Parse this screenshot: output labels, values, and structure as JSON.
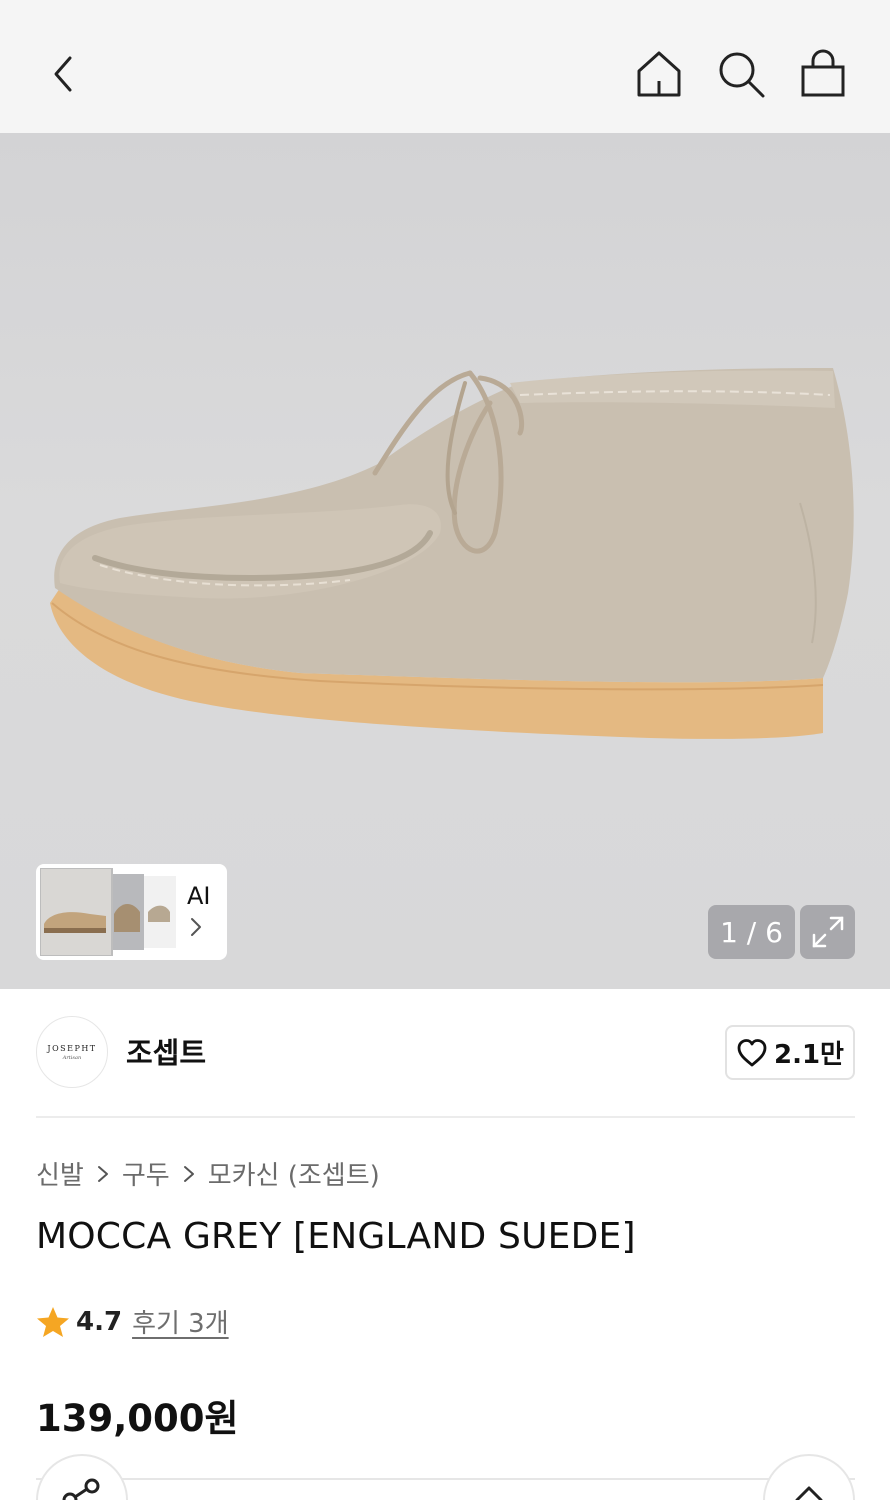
{
  "header": {
    "back_icon": "chevron-left-icon",
    "home_icon": "home-icon",
    "search_icon": "search-icon",
    "cart_icon": "shopping-bag-icon"
  },
  "gallery": {
    "counter": "1 / 6",
    "ai_label": "AI",
    "expand_icon": "expand-icon",
    "current_index": 1,
    "total": 6
  },
  "brand": {
    "name": "조셉트",
    "logo_text": "JOSEPHT",
    "logo_subtext": "Artisan",
    "like_count": "2.1만"
  },
  "breadcrumb": {
    "items": [
      "신발",
      "구두",
      "모카신 (조셉트)"
    ]
  },
  "product": {
    "title": "MOCCA GREY [ENGLAND SUEDE]",
    "rating": "4.7",
    "reviews": "후기 3개",
    "price": "139,000원"
  },
  "colors": {
    "star": "#f5a623",
    "topbar_bg": "#f5f5f5",
    "hero_bg": "#d6d6d8"
  }
}
